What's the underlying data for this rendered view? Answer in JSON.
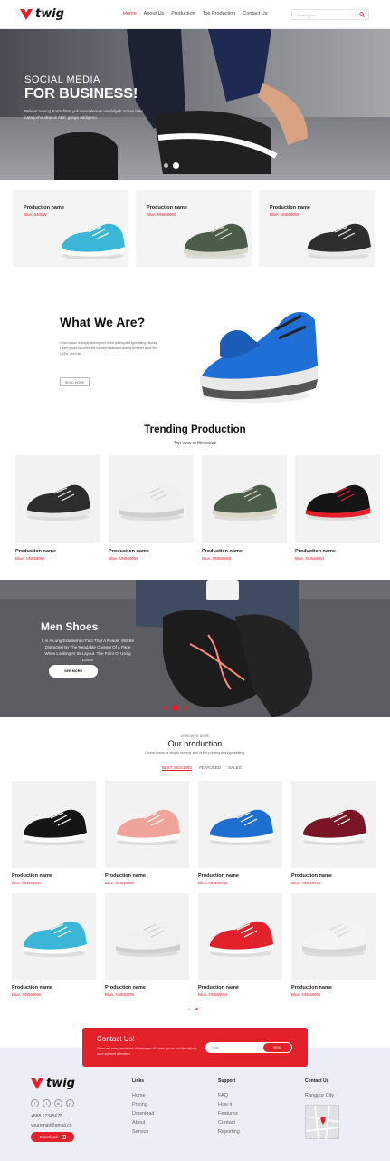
{
  "header": {
    "brand": "twig",
    "nav": [
      {
        "label": "Home",
        "active": true
      },
      {
        "label": "About Us"
      },
      {
        "label": "Production"
      },
      {
        "label": "Top Production"
      },
      {
        "label": "Contact Us"
      }
    ],
    "search_placeholder": "Search here"
  },
  "hero": {
    "line1": "SOCIAL MEDIA",
    "line2": "FOR BUSINESS!",
    "text": "Bebam tuunog Xornafimst yok honoblenum visnhilgeh uchan new natagorhuudtamiz ABC gungo oddigeno.",
    "slides": 2,
    "active_slide": 1
  },
  "featured": [
    {
      "name": "Production name",
      "price": "Blue, 5400W",
      "color": "#3bb6d6",
      "accent": "#ffffff"
    },
    {
      "name": "Production name",
      "price": "Blue, NN5690W",
      "color": "#4b5d4a",
      "accent": "#d9d6c8"
    },
    {
      "name": "Production name",
      "price": "Blue, NN5690W",
      "color": "#2d2d2d",
      "accent": "#e9e9e9"
    }
  ],
  "about": {
    "title": "What We Are?",
    "text": "Lorem Ipsum is simply dummy text of the printing and typesetting industry. Lorem Ipsum has been the industry's standard dummy text ever since the 1500s, when an",
    "button": "READ MORE"
  },
  "trending": {
    "title": "Trending Production",
    "subtitle": "Top view in this week",
    "items": [
      {
        "name": "Production name",
        "price": "Blue, NN5690W",
        "color": "#2d2d2d",
        "accent": "#e9e9e9"
      },
      {
        "name": "Production name",
        "price": "Blue, NN5690W",
        "color": "#f0f0f0",
        "accent": "#cfcfcf"
      },
      {
        "name": "Production name",
        "price": "Blue, NN5690W",
        "color": "#4b5d4a",
        "accent": "#d9d6c8"
      },
      {
        "name": "Production name",
        "price": "Blue, NN5690W",
        "color": "#151515",
        "accent": "#e3212b"
      }
    ]
  },
  "men": {
    "title": "Men Shoes",
    "text": "It Is A Long Established Fact That A Reader Will Be Distracted By The Readable Content Of A Page When Looking At Its Layout. The Point Of Using Lorem",
    "button": "SEE MORE",
    "slides": 3,
    "active_slide": 1
  },
  "our": {
    "eyebrow": "WORDWIDE MORE",
    "title": "Our production",
    "subtitle": "Lorem Ipsum is simply dummy text of the printing and typesetting.",
    "tabs": [
      {
        "label": "BEST SELLERS",
        "active": true
      },
      {
        "label": "FEATURED"
      },
      {
        "label": "SALES"
      }
    ],
    "items": [
      {
        "name": "Production name",
        "price": "Blue, NN5690W",
        "color": "#151515",
        "accent": "#ffffff"
      },
      {
        "name": "Production name",
        "price": "Blue, NN5690W",
        "color": "#f0a39a",
        "accent": "#ffffff"
      },
      {
        "name": "Production name",
        "price": "Blue, NN5690W",
        "color": "#1e6fd0",
        "accent": "#ffffff"
      },
      {
        "name": "Production name",
        "price": "Blue, NN5690W",
        "color": "#7a1526",
        "accent": "#ffffff"
      },
      {
        "name": "Production name",
        "price": "Blue, NN5690W",
        "color": "#3bb6d6",
        "accent": "#ffffff"
      },
      {
        "name": "Production name",
        "price": "Blue, NN5690W",
        "color": "#f1f1f1",
        "accent": "#cfcfcf"
      },
      {
        "name": "Production name",
        "price": "Blue, NN5690W",
        "color": "#e3212b",
        "accent": "#ffffff"
      },
      {
        "name": "Production name",
        "price": "Blue, NN5690W",
        "color": "#f4f4f4",
        "accent": "#d6d6d6"
      }
    ],
    "slides": 2,
    "active_slide": 1
  },
  "contact": {
    "title": "Contact Us!",
    "text": "There are many variations of passages of Lorem Ipsum but the majority have suffered alteration.",
    "placeholder": "Email",
    "button": "SEND"
  },
  "footer": {
    "brand": "twig",
    "social": [
      "f",
      "t",
      "in",
      "p"
    ],
    "phone": "+888 12345678",
    "email": "youremail@gmail.co",
    "download": "Download",
    "links_title": "Links",
    "links": [
      "Home",
      "Pricing",
      "Download",
      "About",
      "Service"
    ],
    "support_title": "Support",
    "support": [
      "FAQ",
      "How it",
      "Features",
      "Contact",
      "Reporting"
    ],
    "contact_title": "Contact Us",
    "city": "Rangpur City"
  },
  "colors": {
    "accent": "#e3212b",
    "footer_bg": "#ecedf6"
  }
}
